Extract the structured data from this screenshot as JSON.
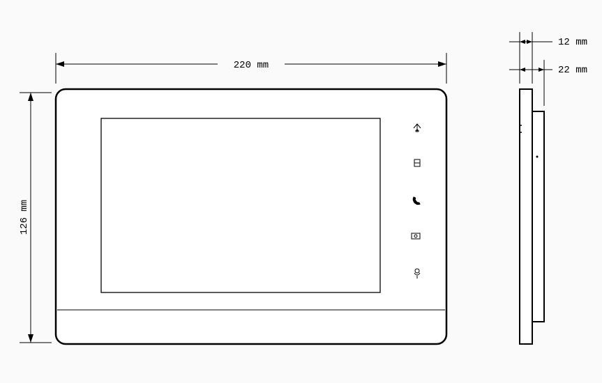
{
  "diagram": {
    "type": "technical-drawing",
    "subject": "video-intercom-monitor",
    "views": [
      "front",
      "side"
    ],
    "units": "mm",
    "dimensions": {
      "width_label": "220 mm",
      "height_label": "126 mm",
      "depth_outer_label": "12 mm",
      "depth_total_label": "22 mm",
      "width_value_mm": 220,
      "height_value_mm": 126,
      "depth_outer_value_mm": 12,
      "depth_total_value_mm": 22
    },
    "front_buttons": [
      {
        "name": "unlock-icon"
      },
      {
        "name": "menu-icon"
      },
      {
        "name": "call-icon"
      },
      {
        "name": "monitor-icon"
      },
      {
        "name": "talk-icon"
      }
    ]
  }
}
